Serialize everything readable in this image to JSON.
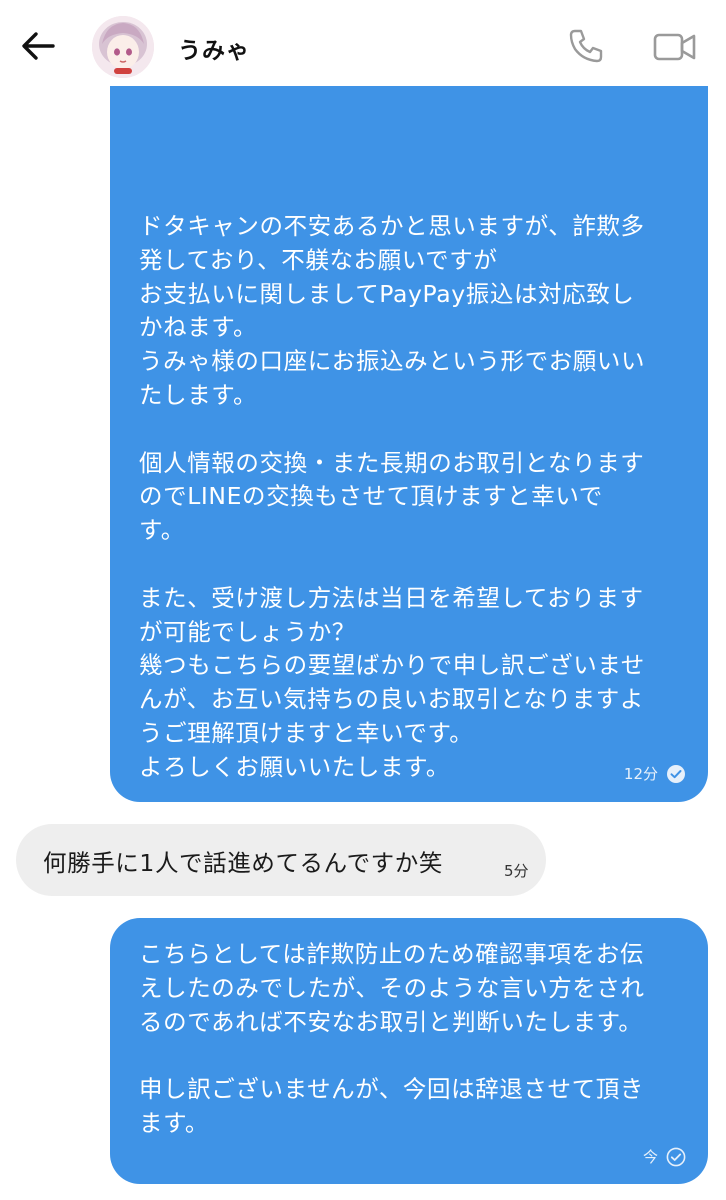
{
  "header": {
    "contact_name": "うみゃ",
    "back_icon": "arrow-left-icon",
    "call_icon": "phone-icon",
    "video_icon": "video-camera-icon"
  },
  "messages": [
    {
      "direction": "outgoing",
      "text": "ドタキャンの不安あるかと思いますが、詐欺多\n発しており、不躾なお願いですが\nお支払いに関しましてPayPay振込は対応致し\nかねます。\nうみゃ様の口座にお振込みという形でお願いい\nたします。\n\n個人情報の交換・また長期のお取引となります\nのでLINEの交換もさせて頂けますと幸いで\nす。\n\nまた、受け渡し方法は当日を希望しております\nが可能でしょうか？\n幾つもこちらの要望ばかりで申し訳ございませ\nんが、お互い気持ちの良いお取引となりますよ\nうご理解頂けますと幸いです。\nよろしくお願いいたします。",
      "time": "12分",
      "status_icon": "read-check-icon"
    },
    {
      "direction": "incoming",
      "text": "何勝手に1人で話進めてるんですか笑",
      "time": "5分"
    },
    {
      "direction": "outgoing",
      "text": "こちらとしては詐欺防止のため確認事項をお伝\nえしたのみでしたが、そのような言い方をされ\nるのであれば不安なお取引と判断いたします。\n\n申し訳ございませんが、今回は辞退させて頂き\nます。",
      "time": "今",
      "status_icon": "sent-check-icon"
    }
  ],
  "colors": {
    "outgoing_bubble": "#3f93e6",
    "incoming_bubble": "#eeeeee",
    "background": "#ffffff"
  }
}
